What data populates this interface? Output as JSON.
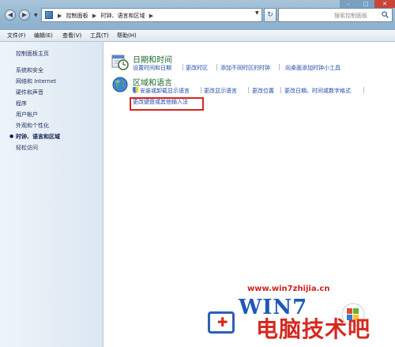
{
  "address_bar": {
    "crumbs": [
      "控制面板",
      "时钟、语言和区域"
    ],
    "separator": "▶",
    "search_placeholder": "搜索控制面板"
  },
  "menu": [
    "文件(F)",
    "编辑(E)",
    "查看(V)",
    "工具(T)",
    "帮助(H)"
  ],
  "sidebar": {
    "home": "控制面板主页",
    "items": [
      "系统和安全",
      "网络和 Internet",
      "硬件和声音",
      "程序",
      "用户帐户",
      "外观和个性化",
      "时钟、语言和区域",
      "轻松访问"
    ],
    "active_index": 6
  },
  "categories": [
    {
      "title": "日期和时间",
      "tasks": [
        "设置时间和日期",
        "更改时区",
        "添加不同时区的时钟",
        "向桌面添加时钟小工具"
      ]
    },
    {
      "title": "区域和语言",
      "tasks": [
        "安装或卸载显示语言",
        "更改显示语言",
        "更改位置",
        "更改日期、时间或数字格式",
        "更改键盘或其他输入法"
      ]
    }
  ],
  "watermark": {
    "url": "www.win7zhijia.cn",
    "logo": "WIN7",
    "brand": "电脑技术吧"
  },
  "colors": {
    "accent_link": "#1e4aa8",
    "category_title": "#1c6a2a",
    "highlight_box": "#d8241d"
  }
}
